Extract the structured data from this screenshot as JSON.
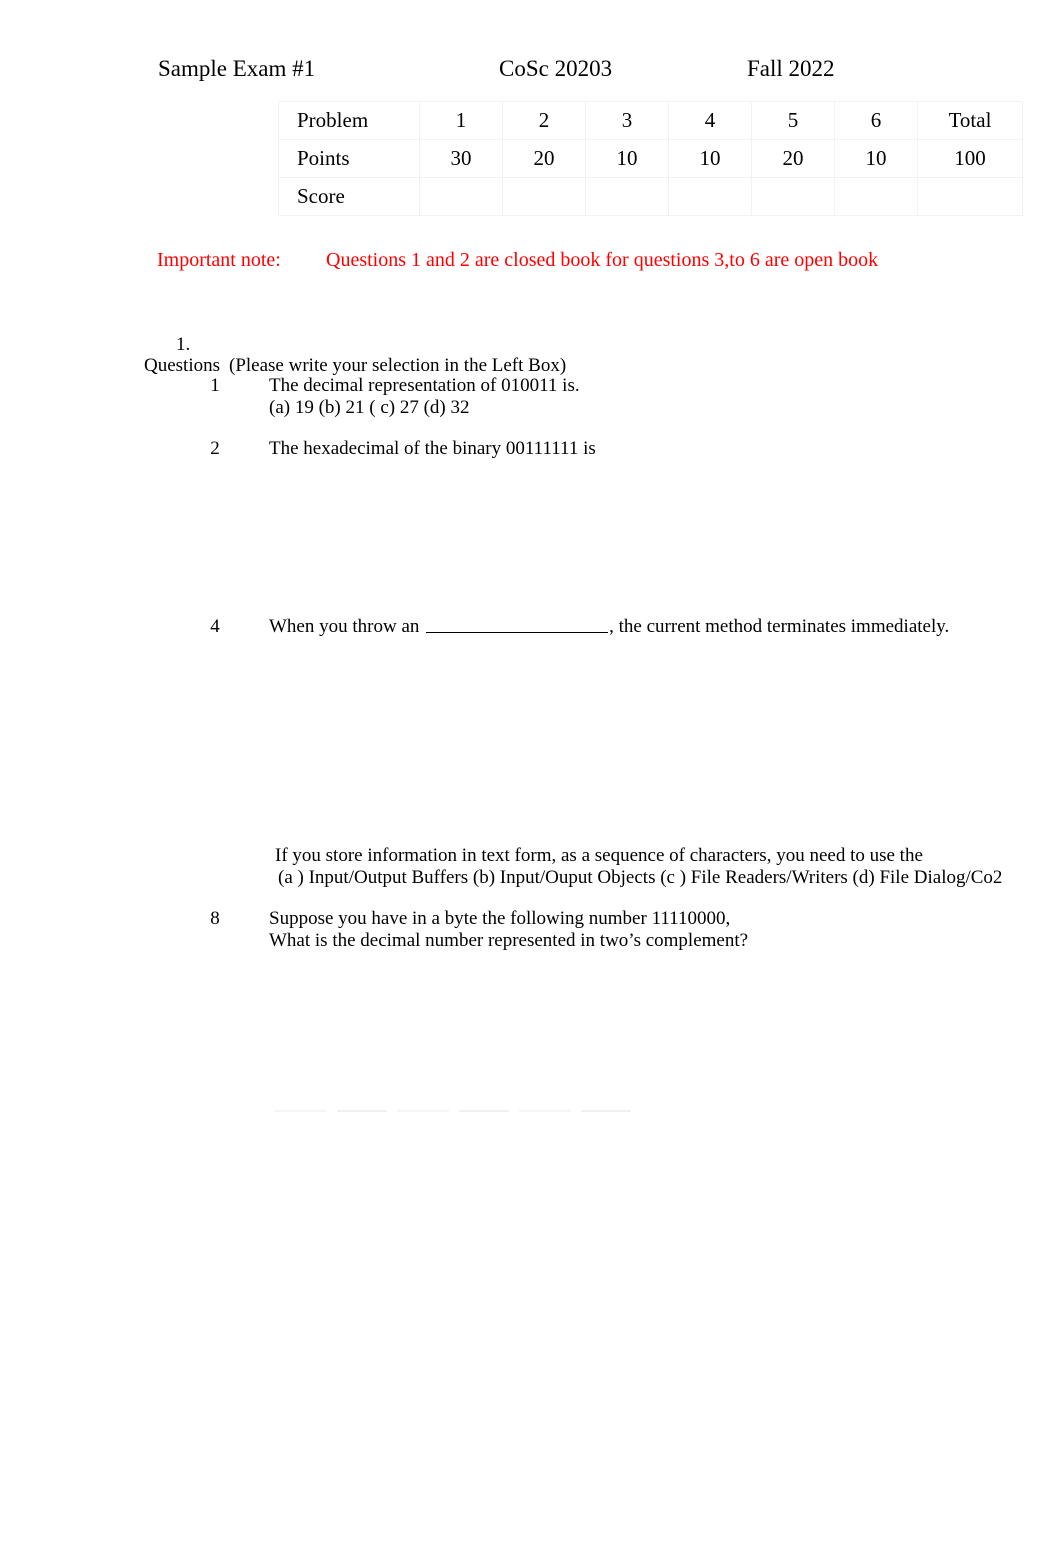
{
  "header": {
    "exam_title": "Sample Exam #1",
    "course": "CoSc 20203",
    "term": "Fall 2022"
  },
  "score_table": {
    "row_labels": [
      "Problem",
      "Points",
      "Score"
    ],
    "problem_numbers": [
      "1",
      "2",
      "3",
      "4",
      "5",
      "6"
    ],
    "total_label": "Total",
    "points": [
      "30",
      "20",
      "10",
      "10",
      "20",
      "10"
    ],
    "points_total": "100",
    "score_values": [
      "",
      "",
      "",
      "",
      "",
      ""
    ],
    "score_total": ""
  },
  "important_note": {
    "label": "Important note:",
    "text": "Questions 1 and 2 are closed book for questions 3,to 6 are open book",
    "color": "#ff0000"
  },
  "section": {
    "numeral": "1.",
    "questions_word": "Questions",
    "instruction": "(Please write your selection in the Left Box)"
  },
  "questions": [
    {
      "number": "1",
      "text": "The decimal representation of   010011 is.",
      "options": "(a)     19      (b)    21    ( c)     27    (d) 32"
    },
    {
      "number": "2",
      "text": "The hexadecimal  of  the binary 00111111    is"
    },
    {
      "number": "4",
      "text_before_blank": "When you throw an ",
      "text_after_blank": ", the current method terminates immediately."
    },
    {
      "number": "8",
      "line1": "Suppose you have in a  byte the following number 11110000,",
      "line2": "What is the decimal number represented in two’s complement?"
    }
  ],
  "loose_question": {
    "line1": "If you store information in text form, as a sequence of characters, you need to use the",
    "line2": "(a ) Input/Output Buffers (b)  Input/Ouput Objects    (c ) File Readers/Writers        (d) File Dialog/Co2"
  }
}
